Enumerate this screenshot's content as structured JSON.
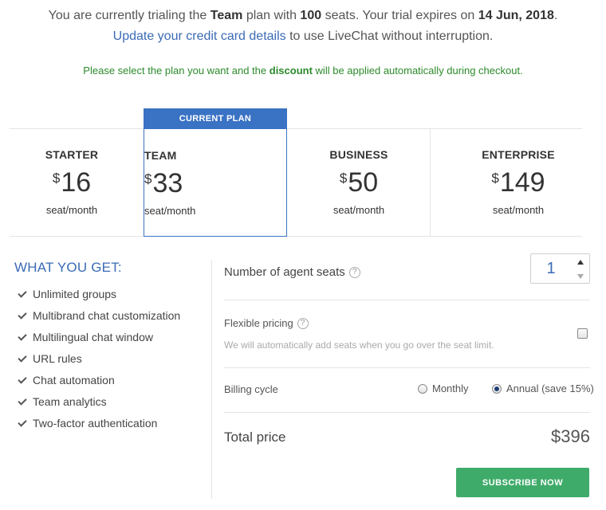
{
  "notice": {
    "trial_prefix": "You are currently trialing the",
    "plan_name": "Team",
    "trial_mid": "plan with",
    "seats": "100",
    "trial_mid2": "seats. Your trial expires on",
    "expiry_date": "14 Jun, 2018",
    "trial_suffix": ".",
    "update_link": "Update your credit card details",
    "update_suffix": "to use LiveChat without interruption.",
    "select_prefix": "Please select the plan you want and the",
    "select_bold": "discount",
    "select_suffix": "will be applied automatically during checkout."
  },
  "plans": {
    "current_banner": "CURRENT PLAN",
    "items": [
      {
        "name": "STARTER",
        "currency": "$",
        "price": "16",
        "unit": "seat/month"
      },
      {
        "name": "TEAM",
        "currency": "$",
        "price": "33",
        "unit": "seat/month"
      },
      {
        "name": "BUSINESS",
        "currency": "$",
        "price": "50",
        "unit": "seat/month"
      },
      {
        "name": "ENTERPRISE",
        "currency": "$",
        "price": "149",
        "unit": "seat/month"
      }
    ]
  },
  "features": {
    "title": "WHAT YOU GET:",
    "items": [
      "Unlimited groups",
      "Multibrand chat customization",
      "Multilingual chat window",
      "URL rules",
      "Chat automation",
      "Team analytics",
      "Two-factor authentication"
    ]
  },
  "config": {
    "seats_label": "Number of agent seats",
    "seats_value": "1",
    "help_glyph": "?",
    "flexible_label": "Flexible pricing",
    "flexible_description": "We will automatically add seats when you go over the seat limit.",
    "flexible_checked": false,
    "billing_label": "Billing cycle",
    "billing_monthly": "Monthly",
    "billing_annual": "Annual (save 15%)",
    "billing_selected": "Annual (save 15%)",
    "total_label": "Total price",
    "total_value": "$396",
    "subscribe_label": "SUBSCRIBE NOW"
  },
  "colors": {
    "accent_blue": "#3a72c4",
    "link_blue": "#3b6bb5",
    "notice_green": "#2c8a2c",
    "subscribe_green": "#3fab6a"
  }
}
